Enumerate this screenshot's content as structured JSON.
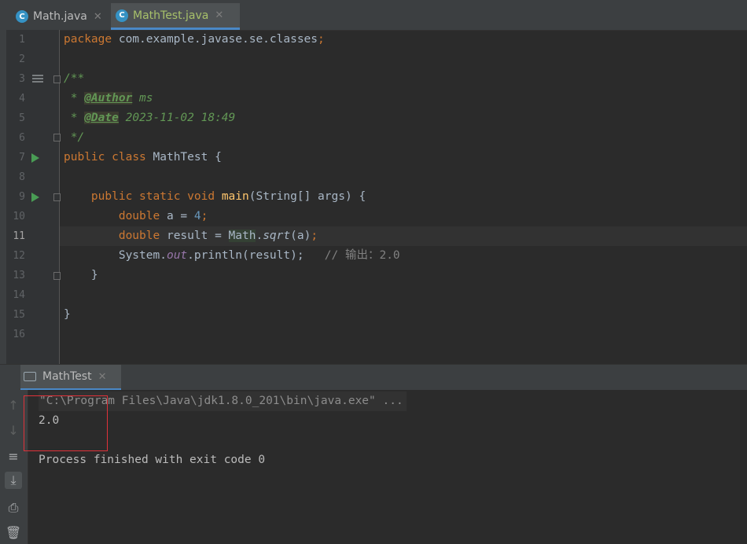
{
  "tabs": [
    {
      "label": "Math.java"
    },
    {
      "label": "MathTest.java"
    }
  ],
  "editor": {
    "line_numbers": [
      "1",
      "2",
      "3",
      "4",
      "5",
      "6",
      "7",
      "8",
      "9",
      "10",
      "11",
      "12",
      "13",
      "14",
      "15",
      "16"
    ],
    "current_line": "11",
    "tokens": {
      "package_kw": "package",
      "package_name": "com.example.javase.se.classes",
      "semicolon": ";",
      "doc_open": "/**",
      "doc_star": " * ",
      "author_tag": "@Author",
      "author_val": " ms",
      "date_tag": "@Date",
      "date_val": " 2023-11-02 18:49",
      "doc_close": " */",
      "public_kw": "public",
      "class_kw": "class",
      "class_name": "MathTest",
      "brace_open": "{",
      "static_kw": "static",
      "void_kw": "void",
      "main_name": "main",
      "main_params": "(String[] args) ",
      "double_kw": "double",
      "var_a_decl": " a = ",
      "num_4": "4",
      "var_result_decl": " result = ",
      "math_cls": "Math",
      "dot": ".",
      "sqrt_fn": "sqrt",
      "sqrt_args": "(a)",
      "system": "System",
      "out_field": "out",
      "println": ".println(result);",
      "comment": "// 输出：2.0",
      "brace_close": "}"
    }
  },
  "run_panel": {
    "tab_label": "MathTest",
    "command": "\"C:\\Program Files\\Java\\jdk1.8.0_201\\bin\\java.exe\" ...",
    "output": "2.0",
    "finish": "Process finished with exit code 0"
  },
  "colors": {
    "editor_bg": "#2b2b2b",
    "keyword": "#cc7832",
    "doc_comment": "#629755",
    "function": "#ffc66d",
    "number": "#6897bb",
    "field": "#9876aa",
    "highlight_box": "#e0323a"
  },
  "icons": [
    "java-class-icon",
    "close-icon",
    "run-icon",
    "fold-icon",
    "structure-icon",
    "console-icon",
    "arrow-up-icon",
    "arrow-down-icon",
    "soft-wrap-icon",
    "scroll-to-end-icon",
    "print-icon",
    "trash-icon"
  ]
}
